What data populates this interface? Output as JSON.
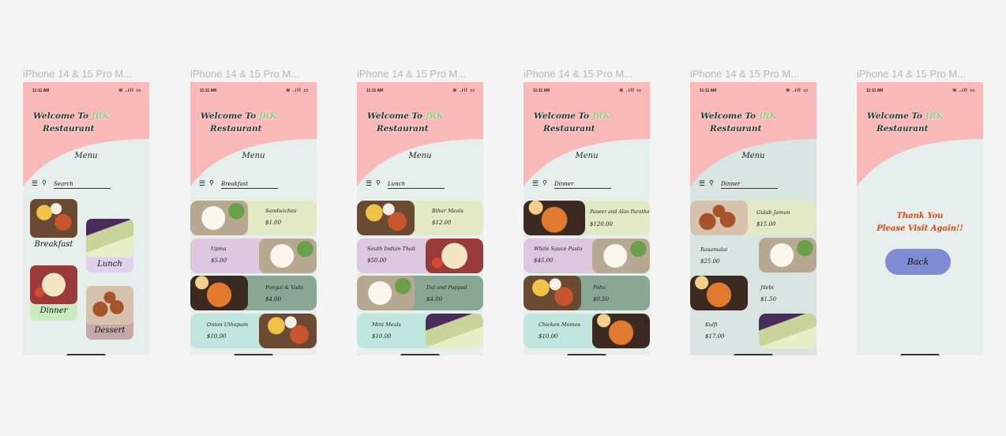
{
  "status_time": "11:11 AM",
  "status_icons": "≋ .ıll ▭",
  "welcome": {
    "line1": "Welcome To ",
    "brand": "JRK",
    "line2": "Restaurant"
  },
  "menu_title": "Menu",
  "frames": [
    {
      "title": "iPhone 14 & 15 Pro M...",
      "search": "Search"
    },
    {
      "title": "iPhone 14 & 15 Pro M...",
      "search": "Breakfast"
    },
    {
      "title": "iPhone 14 & 15 Pro M...",
      "search": "Lunch"
    },
    {
      "title": "iPhone 14 & 15 Pro M...",
      "search": "Dinner"
    },
    {
      "title": "iPhone 14 & 15 Pro M...",
      "search": "Dinner"
    },
    {
      "title": "iPhone 14 & 15 Pro M..."
    }
  ],
  "home_tiles": [
    {
      "label": "Breakfast",
      "color": "#f3f3f3"
    },
    {
      "label": "Lunch",
      "color": "#e0d2ec"
    },
    {
      "label": "Dinner",
      "color": "#c8ecc0"
    },
    {
      "label": "Dessert",
      "color": "#c6a9a6"
    }
  ],
  "breakfast_items": [
    {
      "name": "Sandwiches",
      "price": "$1.00"
    },
    {
      "name": "Upma",
      "price": "$5.00"
    },
    {
      "name": "Pongal & Vada",
      "price": "$4.00"
    },
    {
      "name": "Onion Uthapam",
      "price": "$10.00"
    }
  ],
  "lunch_items": [
    {
      "name": "Bihar Meals",
      "price": "$12.00"
    },
    {
      "name": "South Indian Thali",
      "price": "$50.00"
    },
    {
      "name": "Dal and Pappad",
      "price": "$4.00"
    },
    {
      "name": "Mini Meals",
      "price": "$10.00"
    }
  ],
  "dinner_items": [
    {
      "name": "Paneer and Aloo Paratha",
      "price": "$120.00"
    },
    {
      "name": "White Sauce Pasta",
      "price": "$45.00"
    },
    {
      "name": "Poha",
      "price": "$0.50"
    },
    {
      "name": "Chicken Momos",
      "price": "$10.00"
    }
  ],
  "dessert_items": [
    {
      "name": "Gulab Jamun",
      "price": "$15.00"
    },
    {
      "name": "Rasamalai",
      "price": "$25.00"
    },
    {
      "name": "Jilebi",
      "price": "$1.50"
    },
    {
      "name": "Kulfi",
      "price": "$17.00"
    }
  ],
  "card_colors": [
    "#e3e9c4",
    "#dcc7df",
    "#8aa796",
    "#c1e6df"
  ],
  "thanks": {
    "line1": "Thank You",
    "line2": "Please Visit Again!!"
  },
  "back_label": "Back"
}
